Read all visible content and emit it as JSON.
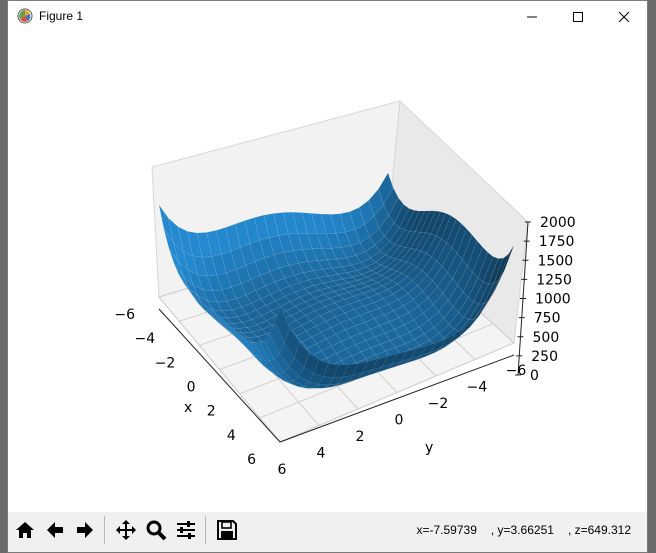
{
  "window": {
    "title": "Figure 1",
    "minimize_icon": "minimize-icon",
    "maximize_icon": "maximize-icon",
    "close_icon": "close-icon"
  },
  "toolbar": {
    "buttons": [
      "home-icon",
      "back-icon",
      "forward-icon",
      "pan-icon",
      "zoom-icon",
      "configure-subplots-icon",
      "save-icon"
    ],
    "status": {
      "x": "x=-7.59739",
      "y": ", y=3.66251",
      "z": ", z=649.312"
    }
  },
  "chart_data": {
    "type": "surface",
    "xlabel": "x",
    "ylabel": "y",
    "zlabel": "",
    "x_ticks": [
      "−6",
      "−4",
      "−2",
      "0",
      "2",
      "4",
      "6"
    ],
    "y_ticks": [
      "−6",
      "−4",
      "−2",
      "0",
      "2",
      "4",
      "6"
    ],
    "z_ticks": [
      "0",
      "250",
      "500",
      "750",
      "1000",
      "1250",
      "1500",
      "1750",
      "2000"
    ],
    "xlim": [
      -6,
      6
    ],
    "ylim": [
      -6,
      6
    ],
    "zlim": [
      0,
      2000
    ],
    "grid": true,
    "surface_color": "#1f77b4"
  }
}
